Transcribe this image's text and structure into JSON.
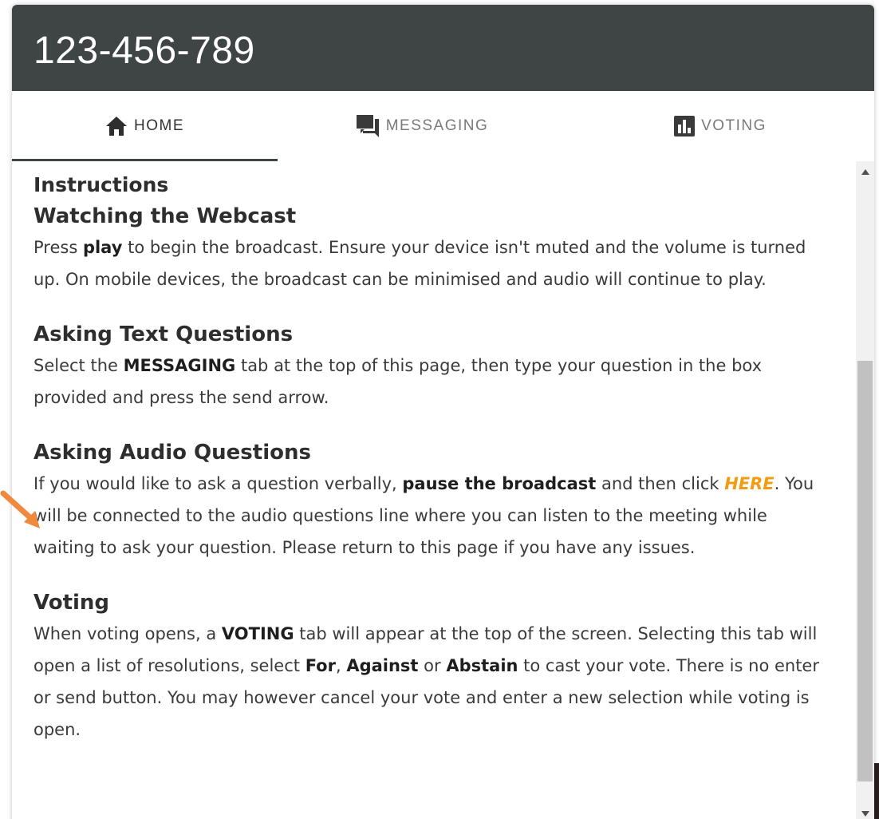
{
  "header": {
    "title": "123-456-789"
  },
  "tabs": [
    {
      "label": "HOME",
      "icon": "home-icon",
      "active": true
    },
    {
      "label": "MESSAGING",
      "icon": "chat-icon",
      "active": false
    },
    {
      "label": "VOTING",
      "icon": "bar-chart-icon",
      "active": false
    }
  ],
  "content": {
    "instructions_title": "Instructions",
    "webcast": {
      "title": "Watching the Webcast",
      "p1": "Press ",
      "bold1": "play",
      "p2": " to begin the broadcast. Ensure your device isn't muted and the volume is turned up. On mobile devices, the broadcast can be minimised and audio will continue to play."
    },
    "text_questions": {
      "title": "Asking Text Questions",
      "p1": "Select the ",
      "bold1": "MESSAGING",
      "p2": " tab at the top of this page, then type your question in the box provided and press the send arrow."
    },
    "audio_questions": {
      "title": "Asking Audio Questions",
      "p1": "If you would like to ask a question verbally, ",
      "bold1": "pause the broadcast",
      "p2": " and then click ",
      "link": "HERE",
      "p3": ". You will be connected to the audio questions line where you can listen to the meeting while waiting to ask your question. Please return to this page if you have any issues."
    },
    "voting": {
      "title": "Voting",
      "p1": "When voting opens, a ",
      "bold1": "VOTING",
      "p2": " tab will appear at the top of the screen. Selecting this tab will open a list of resolutions, select ",
      "bold2": "For",
      "p3": ", ",
      "bold3": "Against",
      "p4": " or ",
      "bold4": "Abstain",
      "p5": " to cast your vote. There is no enter or send button. You may however cancel your vote and enter a new selection while voting is open."
    }
  },
  "colors": {
    "header_bg": "#3e4544",
    "link": "#f39c12",
    "annotation_arrow": "#f0883e"
  }
}
